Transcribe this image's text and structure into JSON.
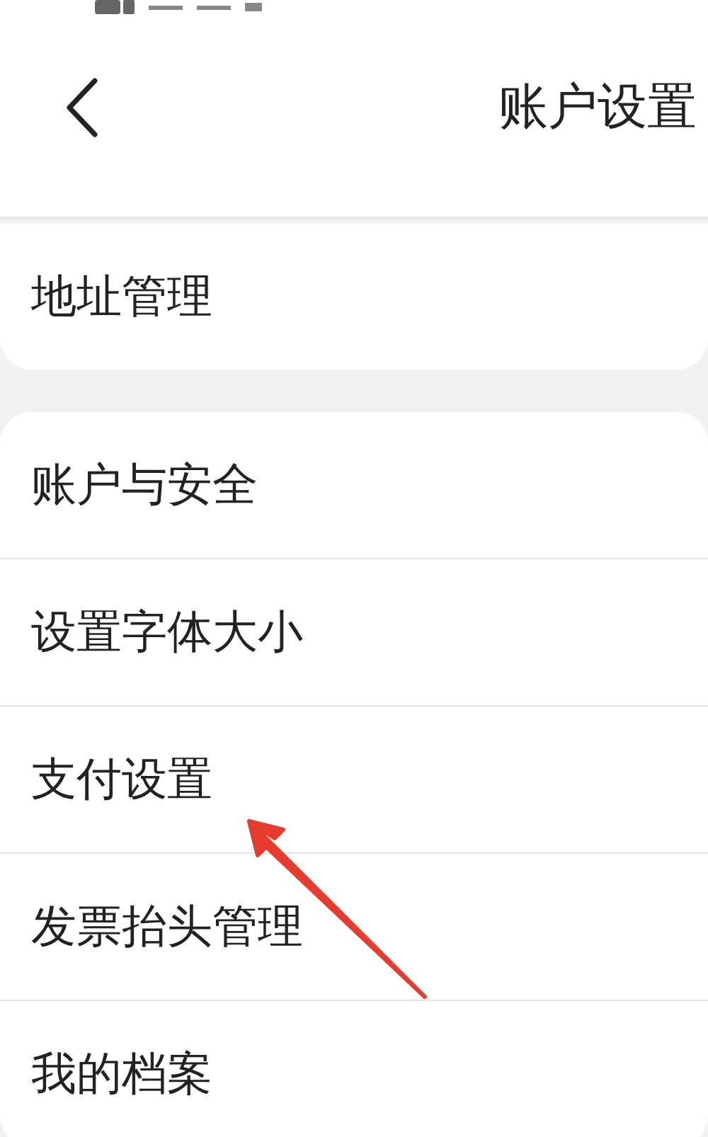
{
  "header": {
    "title": "账户设置"
  },
  "groups": [
    {
      "items": [
        {
          "label": "地址管理"
        }
      ]
    },
    {
      "items": [
        {
          "label": "账户与安全"
        },
        {
          "label": "设置字体大小"
        },
        {
          "label": "支付设置"
        },
        {
          "label": "发票抬头管理"
        },
        {
          "label": "我的档案"
        }
      ]
    }
  ]
}
